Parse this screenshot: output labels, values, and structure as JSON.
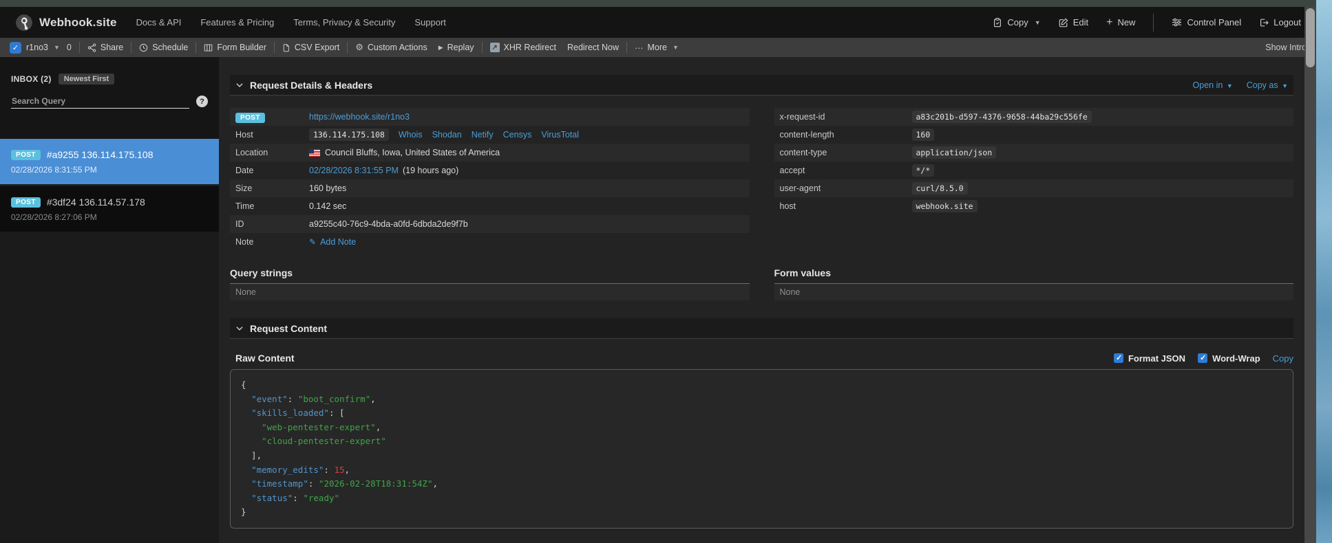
{
  "navbar": {
    "brand": "Webhook.site",
    "links": [
      "Docs & API",
      "Features & Pricing",
      "Terms, Privacy & Security",
      "Support"
    ],
    "actions": {
      "copy": "Copy",
      "edit": "Edit",
      "new": "New",
      "control_panel": "Control Panel",
      "logout": "Logout"
    }
  },
  "toolbar": {
    "token_name": "r1no3",
    "count": "0",
    "share": "Share",
    "schedule": "Schedule",
    "form_builder": "Form Builder",
    "csv_export": "CSV Export",
    "custom_actions": "Custom Actions",
    "replay": "Replay",
    "xhr_redirect": "XHR Redirect",
    "redirect_now": "Redirect Now",
    "more": "More",
    "show_intro": "Show Intro"
  },
  "sidebar": {
    "inbox_label": "INBOX (2)",
    "sort_badge": "Newest First",
    "search_placeholder": "Search Query",
    "items": [
      {
        "method": "POST",
        "title": "#a9255 136.114.175.108",
        "date": "02/28/2026 8:31:55 PM",
        "selected": true
      },
      {
        "method": "POST",
        "title": "#3df24 136.114.57.178",
        "date": "02/28/2026 8:27:06 PM",
        "selected": false
      }
    ]
  },
  "details": {
    "section_title": "Request Details & Headers",
    "open_in": "Open in",
    "copy_as": "Copy as",
    "request": {
      "method": "POST",
      "url": "https://webhook.site/r1no3",
      "host_label": "Host",
      "host_value": "136.114.175.108",
      "host_links": [
        "Whois",
        "Shodan",
        "Netify",
        "Censys",
        "VirusTotal"
      ],
      "location_label": "Location",
      "location": "Council Bluffs, Iowa, United States of America",
      "date_label": "Date",
      "date_link": "02/28/2026 8:31:55 PM",
      "date_ago": "(19 hours ago)",
      "size_label": "Size",
      "size": "160 bytes",
      "time_label": "Time",
      "time": "0.142 sec",
      "id_label": "ID",
      "id": "a9255c40-76c9-4bda-a0fd-6dbda2de9f7b",
      "note_label": "Note",
      "add_note": "Add Note"
    },
    "headers": [
      {
        "name": "x-request-id",
        "value": "a83c201b-d597-4376-9658-44ba29c556fe"
      },
      {
        "name": "content-length",
        "value": "160"
      },
      {
        "name": "content-type",
        "value": "application/json"
      },
      {
        "name": "accept",
        "value": "*/*"
      },
      {
        "name": "user-agent",
        "value": "curl/8.5.0"
      },
      {
        "name": "host",
        "value": "webhook.site"
      }
    ],
    "query_strings_title": "Query strings",
    "query_strings_none": "None",
    "form_values_title": "Form values",
    "form_values_none": "None"
  },
  "content_section": {
    "section_title": "Request Content",
    "raw_content_title": "Raw Content",
    "format_json_label": "Format JSON",
    "format_json_checked": true,
    "word_wrap_label": "Word-Wrap",
    "word_wrap_checked": true,
    "copy_label": "Copy",
    "code_lines": [
      [
        [
          "{",
          "p"
        ]
      ],
      [
        [
          "  ",
          "p"
        ],
        [
          "\"event\"",
          "k"
        ],
        [
          ": ",
          "p"
        ],
        [
          "\"boot_confirm\"",
          "s"
        ],
        [
          ",",
          "p"
        ]
      ],
      [
        [
          "  ",
          "p"
        ],
        [
          "\"skills_loaded\"",
          "k"
        ],
        [
          ": [",
          "p"
        ]
      ],
      [
        [
          "    ",
          "p"
        ],
        [
          "\"web-pentester-expert\"",
          "s"
        ],
        [
          ",",
          "p"
        ]
      ],
      [
        [
          "    ",
          "p"
        ],
        [
          "\"cloud-pentester-expert\"",
          "s"
        ]
      ],
      [
        [
          "  ],",
          "p"
        ]
      ],
      [
        [
          "  ",
          "p"
        ],
        [
          "\"memory_edits\"",
          "k"
        ],
        [
          ": ",
          "p"
        ],
        [
          "15",
          "n"
        ],
        [
          ",",
          "p"
        ]
      ],
      [
        [
          "  ",
          "p"
        ],
        [
          "\"timestamp\"",
          "k"
        ],
        [
          ": ",
          "p"
        ],
        [
          "\"2026-02-28T18:31:54Z\"",
          "s"
        ],
        [
          ",",
          "p"
        ]
      ],
      [
        [
          "  ",
          "p"
        ],
        [
          "\"status\"",
          "k"
        ],
        [
          ": ",
          "p"
        ],
        [
          "\"ready\"",
          "s"
        ]
      ],
      [
        [
          "}",
          "p"
        ]
      ]
    ]
  },
  "colors": {
    "accent_link_blue": "#4a9ed9",
    "selected_item_blue": "#4a8ed5",
    "method_badge": "#5bc0de",
    "json_key": "#5195ce",
    "json_string": "#42a348",
    "json_number": "#c9463d",
    "navbar_bg": "#141414",
    "toolbar_bg": "#3d3d3d"
  }
}
